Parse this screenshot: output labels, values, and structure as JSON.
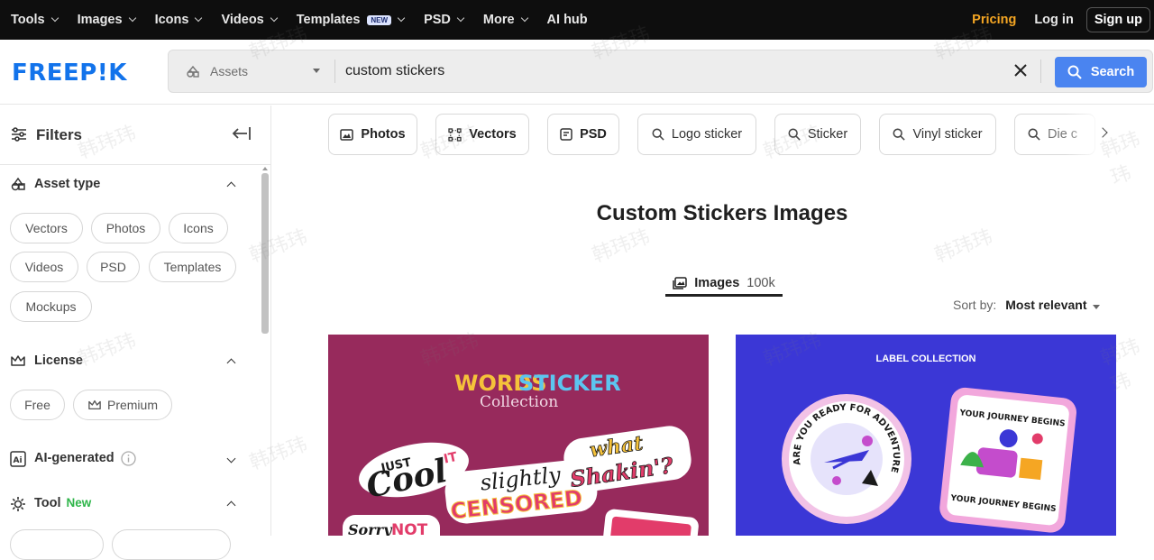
{
  "topnav": {
    "items": [
      {
        "label": "Tools",
        "dropdown": true
      },
      {
        "label": "Images",
        "dropdown": true
      },
      {
        "label": "Icons",
        "dropdown": true
      },
      {
        "label": "Videos",
        "dropdown": true
      },
      {
        "label": "Templates",
        "badge": "NEW",
        "dropdown": true
      },
      {
        "label": "PSD",
        "dropdown": true
      },
      {
        "label": "More",
        "dropdown": true
      },
      {
        "label": "AI hub",
        "dropdown": false
      }
    ],
    "pricing": "Pricing",
    "login": "Log in",
    "signup": "Sign up"
  },
  "header": {
    "logo": "FREEP!K",
    "assets_label": "Assets",
    "search_value": "custom stickers",
    "search_button": "Search"
  },
  "sidebar": {
    "title": "Filters",
    "asset_type": {
      "title": "Asset type",
      "chips": [
        "Vectors",
        "Photos",
        "Icons",
        "Videos",
        "PSD",
        "Templates",
        "Mockups"
      ]
    },
    "license": {
      "title": "License",
      "chips": [
        "Free",
        "Premium"
      ]
    },
    "ai_generated": {
      "title": "AI-generated"
    },
    "tool": {
      "title": "Tool",
      "badge": "New"
    }
  },
  "main": {
    "pills": [
      "Photos",
      "Vectors",
      "PSD",
      "Logo sticker",
      "Sticker",
      "Vinyl sticker",
      "Die c"
    ],
    "page_title": "Custom Stickers Images",
    "tab": {
      "label": "Images",
      "count": "100k"
    },
    "sort": {
      "label": "Sort by:",
      "value": "Most relevant"
    },
    "card1": {
      "title_words": "WORDS",
      "title_sticker": "STICKER",
      "subtitle": "Collection",
      "sticker_cool": "Cool",
      "sticker_just": "JUST",
      "sticker_it": "IT",
      "sticker_slightly": "slightly",
      "sticker_censored": "CENSORED",
      "sticker_what": "what",
      "sticker_shakin": "Shakin'?",
      "sticker_sorry": "Sorry",
      "sticker_not": "NOT"
    },
    "card2": {
      "header": "LABEL COLLECTION",
      "circle_text": "ARE YOU READY FOR ADVENTURE",
      "square_top": "YOUR JOURNEY BEGINS",
      "square_bottom": "YOUR JOURNEY BEGINS"
    }
  },
  "watermark": "韩玮玮",
  "colors": {
    "brand": "#1273eb",
    "pricing": "#f5a623",
    "search_button": "#4a84f0",
    "new_badge": "#2fb54a",
    "card1_bg": "#972a5c",
    "card2_bg": "#3b37d6"
  }
}
